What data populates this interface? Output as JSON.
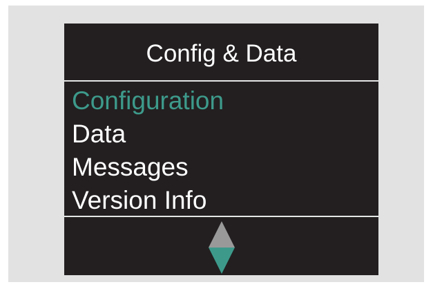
{
  "screen": {
    "title": "Config & Data"
  },
  "menu": {
    "items": [
      {
        "label": "Configuration",
        "selected": true
      },
      {
        "label": "Data",
        "selected": false
      },
      {
        "label": "Messages",
        "selected": false
      },
      {
        "label": "Version Info",
        "selected": false
      }
    ]
  },
  "scroll": {
    "up_icon": "triangle-up-icon",
    "down_icon": "triangle-down-icon"
  },
  "colors": {
    "bezel": "#e2e2e2",
    "screen_background": "#231f20",
    "text": "#ffffff",
    "selected": "#3d9a8b",
    "arrow_up": "#999999",
    "arrow_down": "#3d9a8b",
    "divider": "#e6e6e6"
  }
}
